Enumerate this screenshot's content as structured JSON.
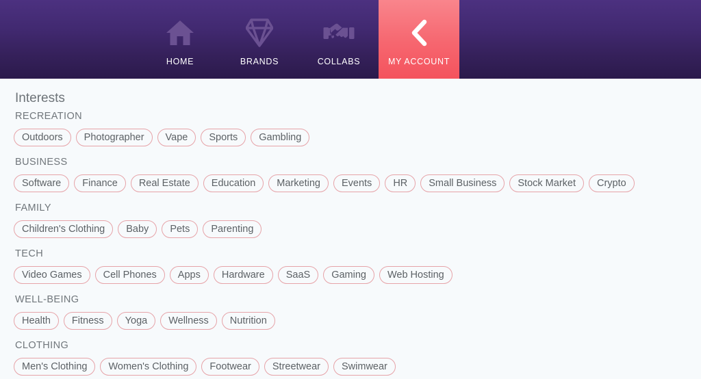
{
  "nav": {
    "items": [
      {
        "label": "HOME",
        "icon": "home-icon",
        "active": false
      },
      {
        "label": "BRANDS",
        "icon": "diamond-icon",
        "active": false
      },
      {
        "label": "COLLABS",
        "icon": "handshake-icon",
        "active": false
      },
      {
        "label": "MY ACCOUNT",
        "icon": "chevron-left-icon",
        "active": true
      }
    ],
    "colors": {
      "background_top": "#4C3180",
      "background_bottom": "#2B1A4B",
      "icon_inactive": "#6B5192",
      "accent_top": "#F9858C",
      "accent_bottom": "#F4535D",
      "label": "#FFFFFF"
    }
  },
  "main": {
    "page_title": "Interests",
    "colors": {
      "page_background": "#F7FAFC",
      "tag_border": "#E6A3A8",
      "tag_text": "#5C6165",
      "heading_text": "#6D7378"
    },
    "categories": [
      {
        "title": "RECREATION",
        "tags": [
          "Outdoors",
          "Photographer",
          "Vape",
          "Sports",
          "Gambling"
        ]
      },
      {
        "title": "BUSINESS",
        "tags": [
          "Software",
          "Finance",
          "Real Estate",
          "Education",
          "Marketing",
          "Events",
          "HR",
          "Small Business",
          "Stock Market",
          "Crypto"
        ]
      },
      {
        "title": "FAMILY",
        "tags": [
          "Children's Clothing",
          "Baby",
          "Pets",
          "Parenting"
        ]
      },
      {
        "title": "TECH",
        "tags": [
          "Video Games",
          "Cell Phones",
          "Apps",
          "Hardware",
          "SaaS",
          "Gaming",
          "Web Hosting"
        ]
      },
      {
        "title": "WELL-BEING",
        "tags": [
          "Health",
          "Fitness",
          "Yoga",
          "Wellness",
          "Nutrition"
        ]
      },
      {
        "title": "CLOTHING",
        "tags": [
          "Men's Clothing",
          "Women's Clothing",
          "Footwear",
          "Streetwear",
          "Swimwear"
        ]
      }
    ]
  }
}
